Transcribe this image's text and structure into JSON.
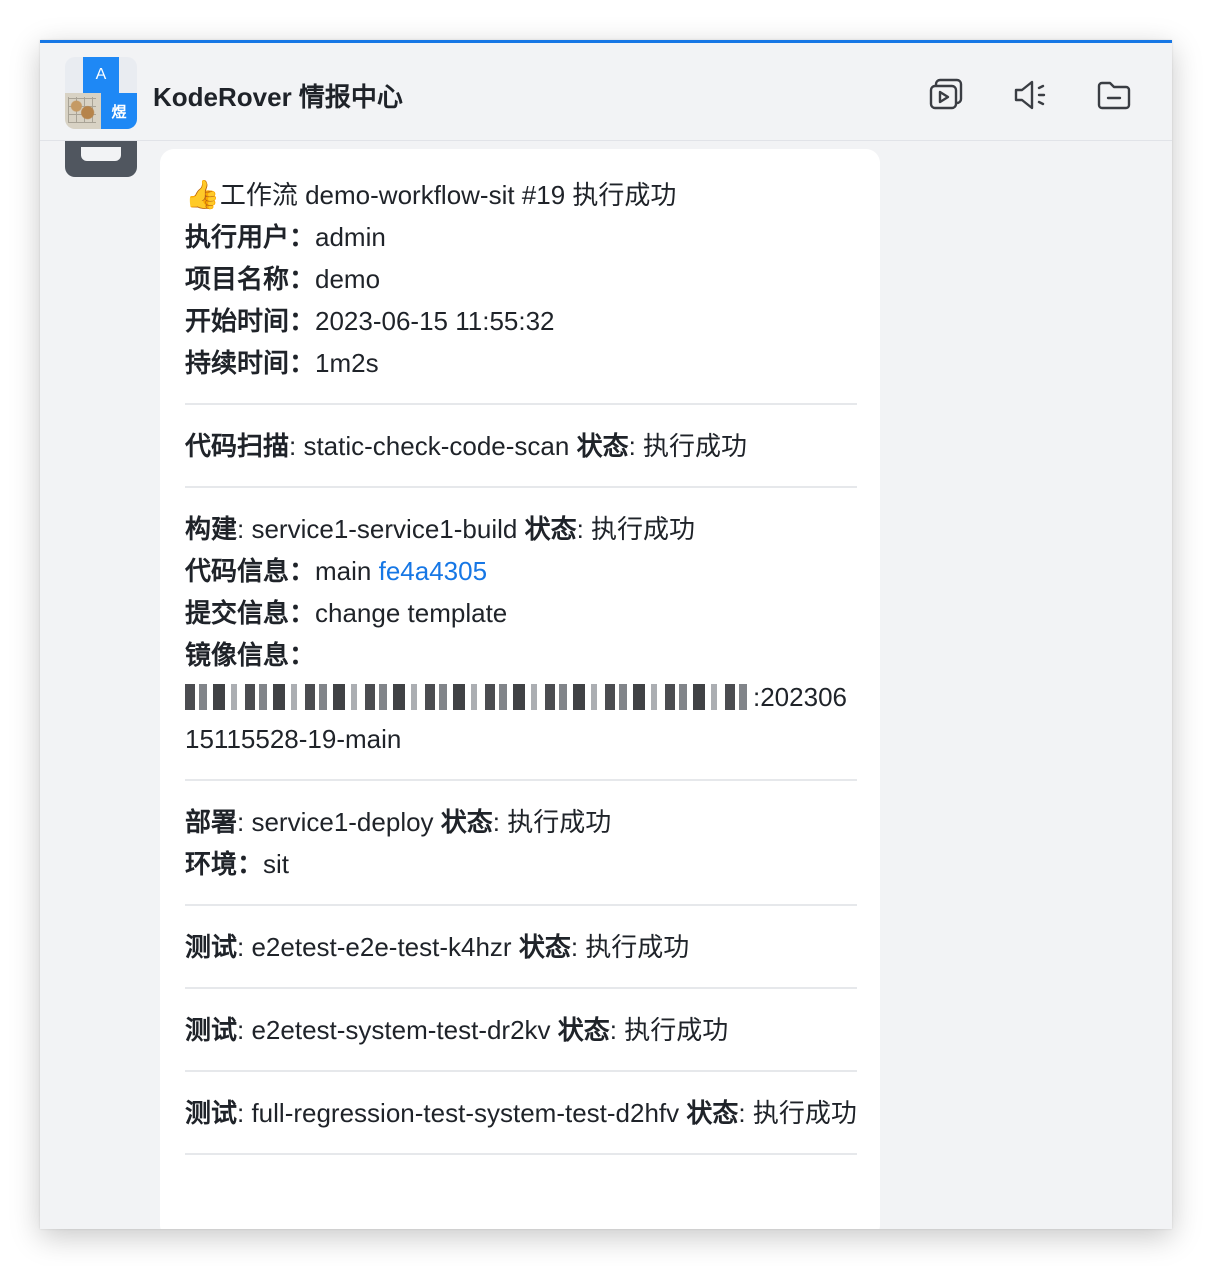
{
  "header": {
    "logo_letters": [
      "A",
      "煜"
    ],
    "title": "KodeRover 情报中心",
    "icons": [
      "video-playlist-icon",
      "speaker-icon",
      "folder-icon"
    ]
  },
  "message": {
    "title_emoji": "👍",
    "title": "工作流 demo-workflow-sit #19 执行成功",
    "executor_label": "执行用户：",
    "executor": "admin",
    "project_label": "项目名称：",
    "project": "demo",
    "start_label": "开始时间：",
    "start_time": "2023-06-15 11:55:32",
    "duration_label": "持续时间：",
    "duration": "1m2s",
    "scan": {
      "label": "代码扫描",
      "name": ": static-check-code-scan ",
      "status_label": "状态",
      "status": ": 执行成功"
    },
    "build": {
      "label": "构建",
      "name": ": service1-service1-build ",
      "status_label": "状态",
      "status": ": 执行成功",
      "code_label": "代码信息：",
      "branch": "main ",
      "commit": "fe4a4305",
      "commit_msg_label": "提交信息：",
      "commit_msg": "change template",
      "image_label": "镜像信息：",
      "image_tag": ":20230615115528-19-main"
    },
    "deploy": {
      "label": "部署",
      "name": ": service1-deploy ",
      "status_label": "状态",
      "status": ": 执行成功",
      "env_label": "环境：",
      "env": "sit"
    },
    "tests": [
      {
        "label": "测试",
        "name": ": e2etest-e2e-test-k4hzr ",
        "status_label": "状态",
        "status": ": 执行成功"
      },
      {
        "label": "测试",
        "name": ": e2etest-system-test-dr2kv ",
        "status_label": "状态",
        "status": ": 执行成功"
      },
      {
        "label": "测试",
        "name": ": full-regression-test-system-test-d2hfv ",
        "status_label": "状态",
        "status": ": 执行成功"
      }
    ]
  },
  "colors": {
    "accent": "#1677e5",
    "window_bg": "#f2f3f5",
    "text": "#1f2329",
    "link": "#1677e5"
  }
}
